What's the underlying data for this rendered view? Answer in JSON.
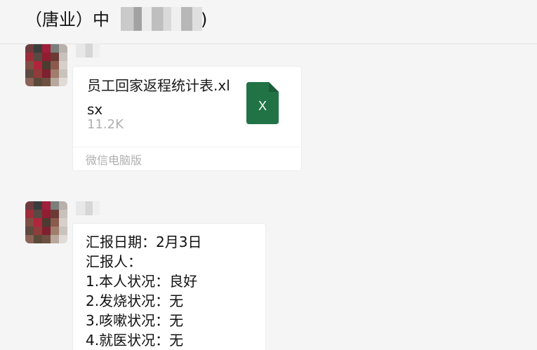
{
  "header": {
    "title_prefix": "（唐业）中",
    "title_suffix": ")"
  },
  "file_message": {
    "file_name": "员工回家返程统计表.xlsx",
    "file_size": "11.2K",
    "file_icon": "excel-icon",
    "file_icon_letter": "X",
    "source": "微信电脑版",
    "colors": {
      "excel_green": "#217346"
    }
  },
  "text_message": {
    "lines": [
      "汇报日期：2月3日",
      "汇报人：",
      "1.本人状况：良好",
      "2.发烧状况：无",
      "3.咳嗽状况：无",
      "4.就医状况：无"
    ]
  }
}
